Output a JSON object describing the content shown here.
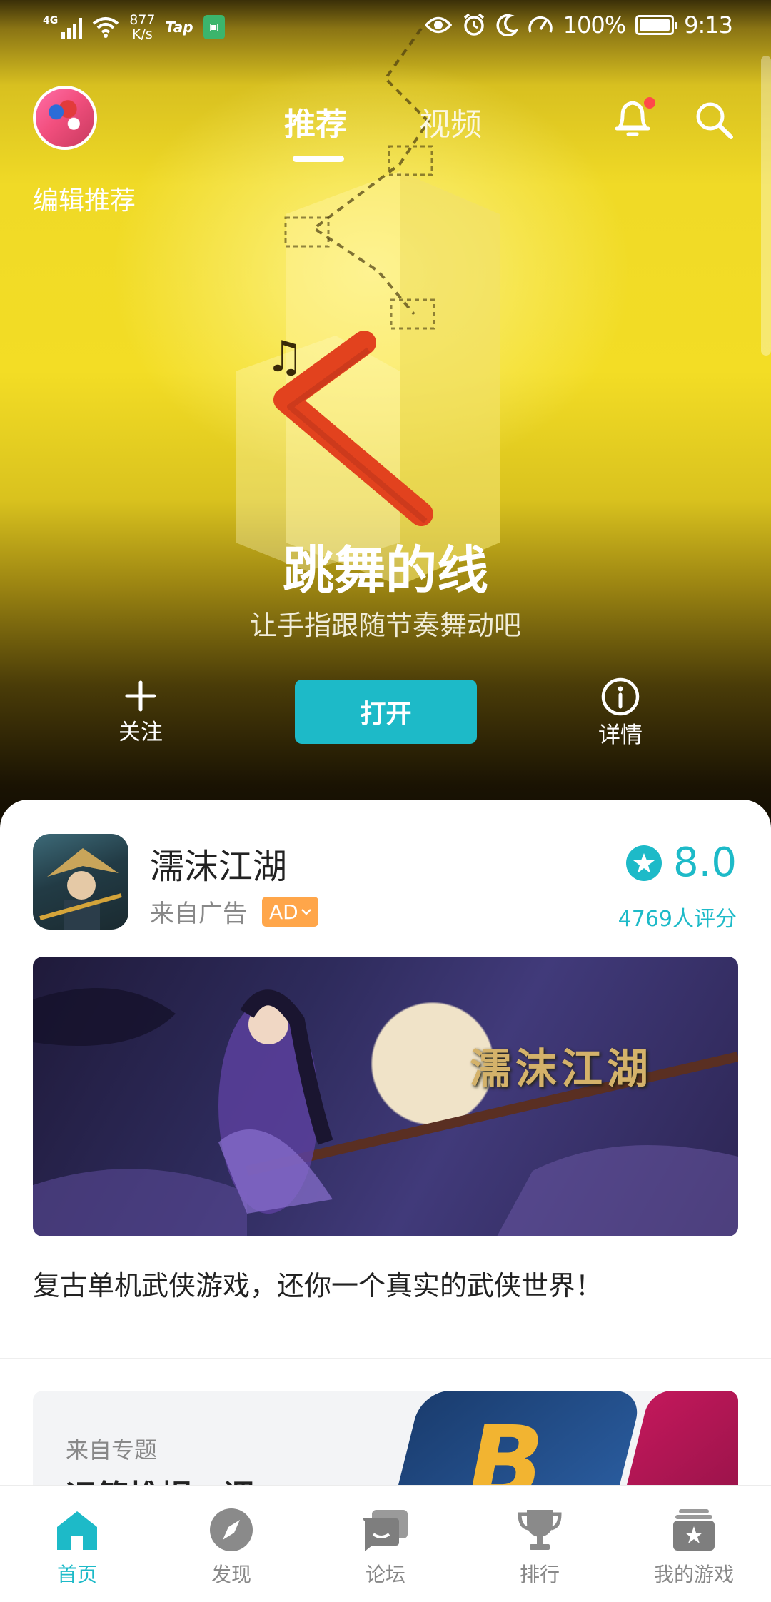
{
  "status_bar": {
    "network": "4G",
    "speed_value": "877",
    "speed_unit": "K/s",
    "tap_label": "Tap",
    "battery": "100%",
    "time": "9:13"
  },
  "top_nav": {
    "tabs": [
      {
        "label": "推荐",
        "active": true
      },
      {
        "label": "视频",
        "active": false
      }
    ]
  },
  "hero": {
    "section_label": "编辑推荐",
    "game_title": "跳舞的线",
    "game_subtitle": "让手指跟随节奏舞动吧",
    "follow_label": "关注",
    "open_label": "打开",
    "detail_label": "详情"
  },
  "ad_card": {
    "name": "濡沫江湖",
    "source": "来自广告",
    "badge": "AD",
    "rating": "8.0",
    "rating_count": "4769人评分",
    "banner_logo": "濡沫江湖",
    "description": "复古单机武侠游戏，还你一个真实的武侠世界！"
  },
  "topic_card": {
    "source": "来自专题",
    "title": "运筹帷幄，调"
  },
  "bottom_nav": {
    "items": [
      {
        "label": "首页",
        "icon": "home-icon",
        "active": true
      },
      {
        "label": "发现",
        "icon": "compass-icon",
        "active": false
      },
      {
        "label": "论坛",
        "icon": "forum-icon",
        "active": false
      },
      {
        "label": "排行",
        "icon": "trophy-icon",
        "active": false
      },
      {
        "label": "我的游戏",
        "icon": "my-games-icon",
        "active": false
      }
    ]
  },
  "colors": {
    "accent": "#1dbac8",
    "ad_badge": "#ffa64a",
    "notification_dot": "#ff4a4a"
  }
}
